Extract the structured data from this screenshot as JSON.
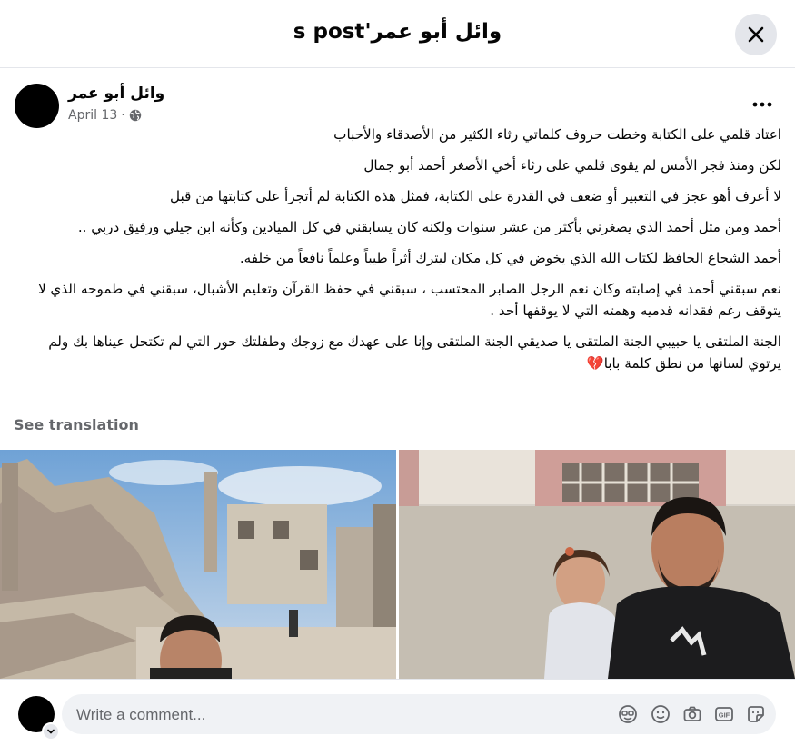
{
  "header": {
    "title": "وائل أبو عمر's post"
  },
  "post": {
    "author": "وائل أبو عمر",
    "date": "April 13",
    "separator": "·",
    "paragraphs": [
      "اعتاد قلمي على الكتابة وخطت حروف كلماتي رثاء الكثير من الأصدقاء والأحباب",
      "لكن ومنذ فجر الأمس لم يقوى قلمي على رثاء أخي الأصغر أحمد أبو جمال",
      "لا أعرف أهو عجز في التعبير أو ضعف في القدرة على الكتابة، فمثل هذه الكتابة لم أتجرأ على كتابتها من قبل",
      "أحمد ومن مثل أحمد الذي يصغرني بأكثر من عشر سنوات ولكنه كان يسابقني في كل الميادين وكأنه ابن جيلي ورفيق دربي ..",
      "أحمد الشجاع الحافظ لكتاب الله الذي يخوض في كل مكان ليترك أثراً طيباً وعلماً نافعاً من خلفه.",
      "نعم سبقني أحمد في إصابته وكان نعم الرجل الصابر المحتسب ، سبقني في حفظ القرآن وتعليم الأشبال، سبقني في طموحه الذي لا يتوقف رغم فقدانه قدميه وهمته التي لا يوقفها أحد .",
      "الجنة الملتقى يا حبيبي الجنة الملتقى يا صديقي الجنة الملتقى وإنا على عهدك مع زوجك وطفلتك حور التي لم تكتحل عيناها بك ولم يرتوي لسانها من نطق كلمة بابا💔"
    ],
    "see_translation": "See translation"
  },
  "comment": {
    "placeholder": "Write a comment..."
  },
  "icons": [
    "close-icon",
    "globe-icon",
    "more-icon",
    "chevron-down-icon",
    "avatar-sticker-icon",
    "emoji-icon",
    "camera-icon",
    "gif-icon",
    "sticker-icon"
  ],
  "colors": {
    "accent": "#050505",
    "muted": "#65676b",
    "input_bg": "#f0f2f5"
  }
}
